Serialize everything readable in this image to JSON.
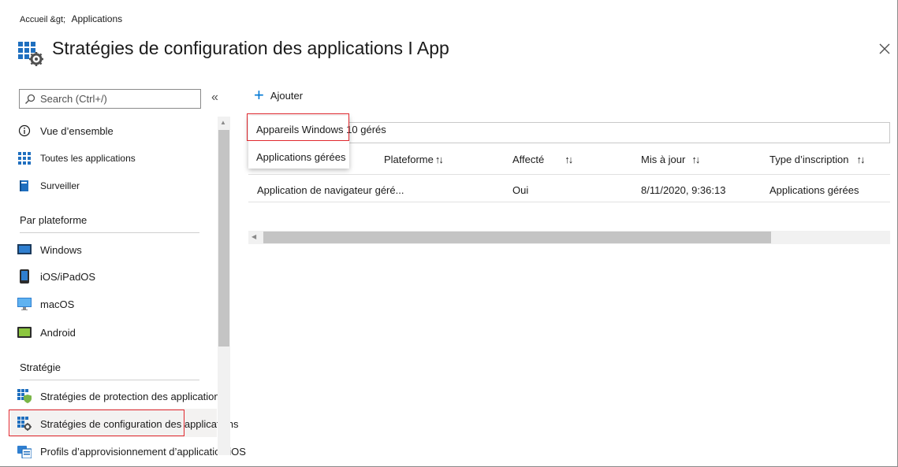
{
  "breadcrumb": {
    "home": "Accueil &gt;",
    "current": "Applications"
  },
  "page": {
    "title": "Stratégies de configuration des applications I App"
  },
  "search": {
    "placeholder": "Search (Ctrl+/)"
  },
  "collapse": "«",
  "sidebar": {
    "top_items": [
      {
        "label": "Vue d’ensemble",
        "icon": "info-icon"
      },
      {
        "label": "Toutes les applications",
        "icon": "apps-grid-icon"
      },
      {
        "label": "Surveiller",
        "icon": "monitor-book-icon"
      }
    ],
    "platform_header": "Par plateforme",
    "platform_items": [
      {
        "label": "Windows",
        "icon": "windows-device-icon"
      },
      {
        "label": "iOS/iPadOS",
        "icon": "ios-device-icon"
      },
      {
        "label": "macOS",
        "icon": "macos-monitor-icon"
      },
      {
        "label": "Android",
        "icon": "android-device-icon"
      }
    ],
    "policy_header": "Stratégie",
    "policy_items": [
      {
        "label": "Stratégies de protection des applications",
        "icon": "app-protection-shield-icon"
      },
      {
        "label": "Stratégies de configuration des applications",
        "icon": "app-config-gear-icon",
        "selected": true
      },
      {
        "label": "Profils d’approvisionnement d’application iOS",
        "icon": "ios-provisioning-icon"
      }
    ]
  },
  "toolbar": {
    "add_label": "Ajouter"
  },
  "dropdown": {
    "items": [
      "Appareils Windows 10 gérés",
      "Applications gérées"
    ]
  },
  "table": {
    "columns": [
      "Plateforme",
      "Affecté",
      "Mis à jour",
      "Type d’inscription"
    ],
    "sort_glyph": "↑↓",
    "rows": [
      {
        "name": "Application de navigateur géré...",
        "assigned": "Oui",
        "updated": "8/11/2020, 9:36:13",
        "enrollment": "Applications gérées"
      }
    ]
  },
  "colors": {
    "accent": "#0078d4",
    "highlight": "#e0282e",
    "selected_bg": "#f3f2f1"
  }
}
